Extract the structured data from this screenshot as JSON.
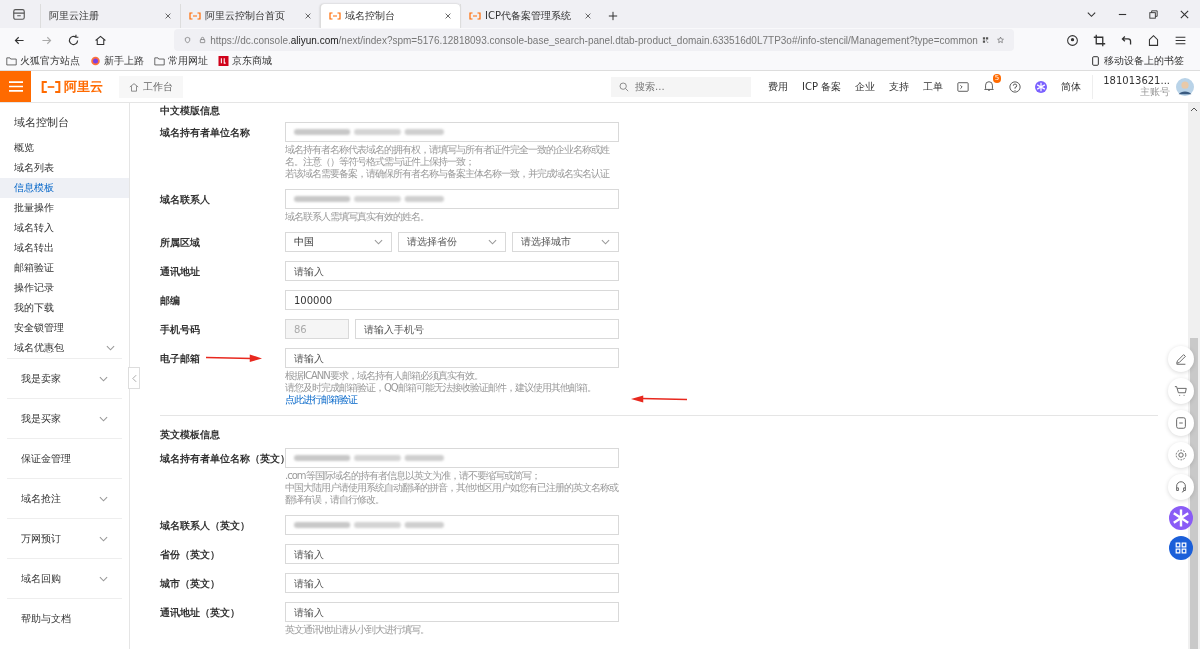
{
  "browser": {
    "tabs": [
      {
        "title": "阿里云注册",
        "selected": false
      },
      {
        "title": "阿里云控制台首页",
        "selected": false
      },
      {
        "title": "域名控制台",
        "selected": true
      },
      {
        "title": "ICP代备案管理系统",
        "selected": false
      }
    ],
    "url_prefix": "https://dc.console.",
    "url_domain": "aliyun.com",
    "url_rest": "/next/index?spm=5176.12818093.console-base_search-panel.dtab-product_domain.633516d0L7TP3o#/info-stencil/Management?type=common",
    "bookmarks": [
      {
        "label": "火狐官方站点"
      },
      {
        "label": "新手上路"
      },
      {
        "label": "常用网址"
      },
      {
        "label": "京东商城"
      }
    ],
    "mobile_bookmarks": "移动设备上的书签"
  },
  "header": {
    "logo": "阿里云",
    "workbench": "工作台",
    "search_placeholder": "搜索...",
    "nav": [
      "费用",
      "ICP 备案",
      "企业",
      "支持",
      "工单"
    ],
    "notification_badge": "5",
    "language": "简体",
    "account": "181013621...",
    "account_role": "主账号"
  },
  "sidebar": {
    "title": "域名控制台",
    "items": [
      {
        "label": "概览",
        "selected": false,
        "expandable": false
      },
      {
        "label": "域名列表",
        "selected": false,
        "expandable": false
      },
      {
        "label": "信息模板",
        "selected": true,
        "expandable": false
      },
      {
        "label": "批量操作",
        "selected": false,
        "expandable": false
      },
      {
        "label": "域名转入",
        "selected": false,
        "expandable": false
      },
      {
        "label": "域名转出",
        "selected": false,
        "expandable": false
      },
      {
        "label": "邮箱验证",
        "selected": false,
        "expandable": false
      },
      {
        "label": "操作记录",
        "selected": false,
        "expandable": false
      },
      {
        "label": "我的下载",
        "selected": false,
        "expandable": false
      },
      {
        "label": "安全锁管理",
        "selected": false,
        "expandable": false
      },
      {
        "label": "域名优惠包",
        "selected": false,
        "expandable": true
      }
    ],
    "groups": [
      {
        "label": "我是卖家",
        "expandable": true
      },
      {
        "label": "我是买家",
        "expandable": true
      },
      {
        "label": "保证金管理",
        "expandable": false
      },
      {
        "label": "域名抢注",
        "expandable": true
      },
      {
        "label": "万网预订",
        "expandable": true
      },
      {
        "label": "域名回购",
        "expandable": true
      },
      {
        "label": "帮助与文档",
        "expandable": false
      }
    ]
  },
  "sections": [
    {
      "title": "中文模版信息",
      "fields": [
        {
          "label": "域名持有者单位名称",
          "kind": "redacted",
          "hints": [
            {
              "text": "域名持有者名称代表域名的拥有权，请填写与所有者证件完全一致的企业名称或姓名。注意（）等符号格式需与证件上保持一致；"
            },
            {
              "text": "若该域名需要备案，请确保所有者名称与备案主体名称一致，并完成域名实名认证"
            }
          ]
        },
        {
          "label": "域名联系人",
          "kind": "redacted",
          "hints": [
            {
              "text": "域名联系人需填写真实有效的姓名。"
            }
          ]
        },
        {
          "label": "所属区域",
          "kind": "selects",
          "selects": [
            {
              "value": "中国"
            },
            {
              "placeholder": "请选择省份"
            },
            {
              "placeholder": "请选择城市"
            }
          ]
        },
        {
          "label": "通讯地址",
          "kind": "input",
          "placeholder": "请输入"
        },
        {
          "label": "邮编",
          "kind": "input",
          "value": "100000"
        },
        {
          "label": "手机号码",
          "kind": "phone",
          "prefix": "86",
          "placeholder": "请输入手机号"
        },
        {
          "label": "电子邮箱",
          "kind": "input",
          "placeholder": "请输入",
          "hints": [
            {
              "text": "根据ICANN要求，域名持有人邮箱必须真实有效。"
            },
            {
              "text": "请您及时完成邮箱验证，QQ邮箱可能无法接收验证邮件，建议使用其他邮箱。",
              "link": "点此进行邮箱验证"
            }
          ]
        }
      ]
    },
    {
      "title": "英文模板信息",
      "fields": [
        {
          "label": "域名持有者单位名称（英文）",
          "kind": "redacted",
          "hints": [
            {
              "text": ".com等国际域名的持有者信息以英文为准，请不要缩写或简写；"
            },
            {
              "text": "中国大陆用户请使用系统自动翻译的拼音，其他地区用户如您有已注册的英文名称或翻译有误，请自行修改。"
            }
          ]
        },
        {
          "label": "域名联系人（英文）",
          "kind": "redacted"
        },
        {
          "label": "省份（英文）",
          "kind": "input",
          "placeholder": "请输入"
        },
        {
          "label": "城市（英文）",
          "kind": "input",
          "placeholder": "请输入"
        },
        {
          "label": "通讯地址（英文）",
          "kind": "input",
          "placeholder": "请输入",
          "hints": [
            {
              "text": "英文通讯地址请从小到大进行填写。"
            }
          ]
        }
      ]
    }
  ]
}
